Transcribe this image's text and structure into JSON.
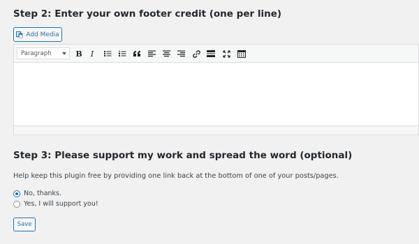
{
  "step2": {
    "title": "Step 2: Enter your own footer credit (one per line)",
    "add_media_label": "Add Media",
    "editor": {
      "format_select_value": "Paragraph",
      "content": "",
      "toolbar_icons": [
        "bold-icon",
        "italic-icon",
        "bulleted-list-icon",
        "numbered-list-icon",
        "blockquote-icon",
        "align-left-icon",
        "align-center-icon",
        "align-right-icon",
        "link-icon",
        "read-more-icon",
        "fullscreen-icon",
        "toolbar-toggle-icon"
      ],
      "bold_glyph": "B",
      "italic_glyph": "I"
    }
  },
  "step3": {
    "title": "Step 3: Please support my work and spread the word (optional)",
    "description": "Help keep this plugin free by providing one link back at the bottom of one of your posts/pages.",
    "options": [
      {
        "label": "No, thanks.",
        "checked": true
      },
      {
        "label": "Yes, I will support you!",
        "checked": false
      }
    ],
    "save_label": "Save"
  },
  "colors": {
    "accent": "#2271b1",
    "background": "#f1f1f1",
    "text": "#23282d"
  }
}
